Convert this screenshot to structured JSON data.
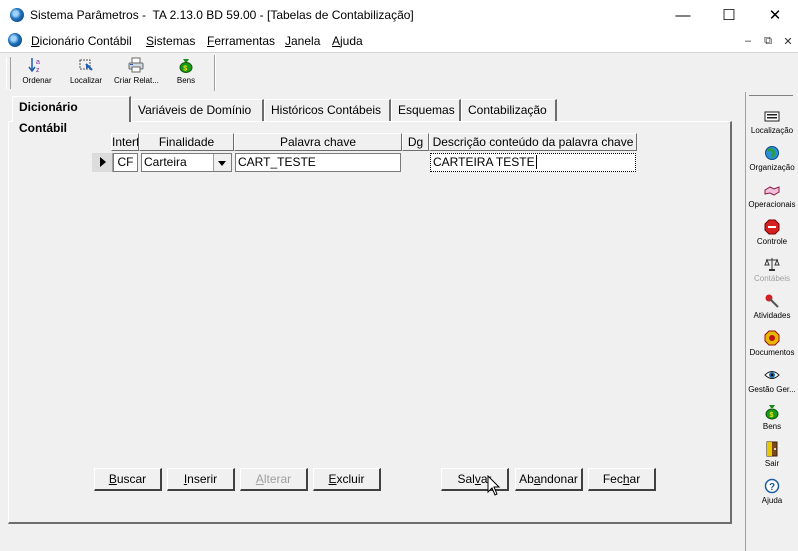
{
  "window": {
    "title": "Sistema Parâmetros -  TA 2.13.0 BD 59.00 - [Tabelas de Contabilização]",
    "controls": {
      "minimize": "—",
      "maximize": "☐",
      "close": "✕"
    }
  },
  "menu": {
    "items": [
      {
        "first": "D",
        "rest": "icionário Contábil"
      },
      {
        "first": "S",
        "rest": "istemas"
      },
      {
        "first": "F",
        "rest": "erramentas"
      },
      {
        "first": "J",
        "rest": "anela"
      },
      {
        "first": "A",
        "rest": "juda"
      }
    ],
    "mdi": {
      "minimize": "–",
      "restore": "⧉",
      "close": "✕"
    }
  },
  "toolbar": {
    "items": [
      {
        "label": "Ordenar",
        "icon": "sort-az-icon"
      },
      {
        "label": "Localizar",
        "icon": "locate-icon"
      },
      {
        "label": "Criar Relat...",
        "icon": "printer-icon"
      },
      {
        "label": "Bens",
        "icon": "money-bag-icon"
      }
    ]
  },
  "tabs": [
    {
      "label": "Dicionário Contábil",
      "active": true
    },
    {
      "label": "Variáveis de Domínio"
    },
    {
      "label": "Históricos Contábeis"
    },
    {
      "label": "Esquemas"
    },
    {
      "label": "Contabilização"
    }
  ],
  "grid": {
    "columns": [
      "Interf",
      "Finalidade",
      "Palavra chave",
      "Dg",
      "Descrição conteúdo da palavra chave"
    ],
    "rows": [
      {
        "interf": "CF",
        "finalidade": "Carteira",
        "palavra_chave": "CART_TESTE",
        "dg": "",
        "descricao": "CARTEIRA TESTE"
      }
    ]
  },
  "buttons": {
    "buscar": {
      "first": "B",
      "rest": "uscar"
    },
    "inserir": {
      "first": "I",
      "rest": "nserir"
    },
    "alterar": {
      "first": "A",
      "rest": "lterar",
      "disabled": true
    },
    "excluir": {
      "first": "E",
      "rest": "xcluir"
    },
    "salvar": {
      "pre": "Sal",
      "ul": "v",
      "post": "ar"
    },
    "abandonar": {
      "pre": "Ab",
      "ul": "a",
      "post": "ndonar"
    },
    "fechar": {
      "pre": "Fec",
      "ul": "h",
      "post": "ar"
    }
  },
  "sidebar": {
    "items": [
      {
        "label": "Localização",
        "icon": "keyboard-icon"
      },
      {
        "label": "Organização",
        "icon": "globe-icon"
      },
      {
        "label": "Operacionais",
        "icon": "handshake-icon"
      },
      {
        "label": "Controle",
        "icon": "stop-sign-icon"
      },
      {
        "label": "Contábeis",
        "icon": "scales-icon",
        "disabled": true
      },
      {
        "label": "Atividades",
        "icon": "pin-icon"
      },
      {
        "label": "Documentos",
        "icon": "document-icon"
      },
      {
        "label": "Gestão Ger...",
        "icon": "eye-icon"
      },
      {
        "label": "Bens",
        "icon": "money-bag-icon"
      },
      {
        "label": "Sair",
        "icon": "exit-door-icon"
      },
      {
        "label": "Ajuda",
        "icon": "help-icon"
      }
    ]
  },
  "colors": {
    "active_dark": "#6d6d6d",
    "disabled_text": "#a0a0a0",
    "face": "#f0f0f0"
  }
}
